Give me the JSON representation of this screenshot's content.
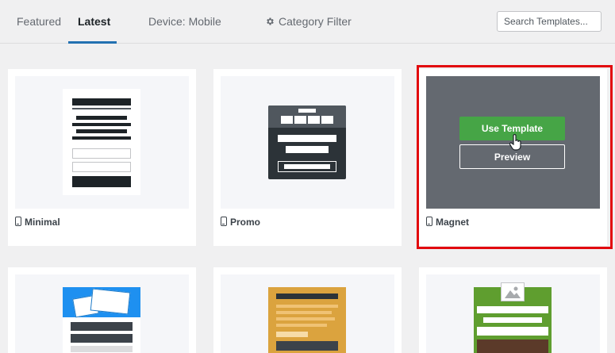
{
  "tabs": [
    {
      "label": "Featured"
    },
    {
      "label": "Latest"
    },
    {
      "label": "Device: Mobile"
    },
    {
      "label": "Category Filter",
      "icon": "gear-icon"
    }
  ],
  "active_tab": "Latest",
  "search": {
    "placeholder": "Search Templates..."
  },
  "templates": [
    {
      "name": "Minimal",
      "device_icon": "mobile-icon"
    },
    {
      "name": "Promo",
      "device_icon": "mobile-icon"
    },
    {
      "name": "Magnet",
      "device_icon": "mobile-icon",
      "hovered": true,
      "highlighted": true
    },
    {
      "name": "",
      "device_icon": ""
    },
    {
      "name": "",
      "device_icon": ""
    },
    {
      "name": "",
      "device_icon": ""
    }
  ],
  "hover_actions": {
    "use_label": "Use Template",
    "preview_label": "Preview"
  },
  "colors": {
    "accent": "#2271b1",
    "use_template_button": "#46a546",
    "highlight_border": "#e2090e",
    "hover_overlay": "#646970"
  }
}
